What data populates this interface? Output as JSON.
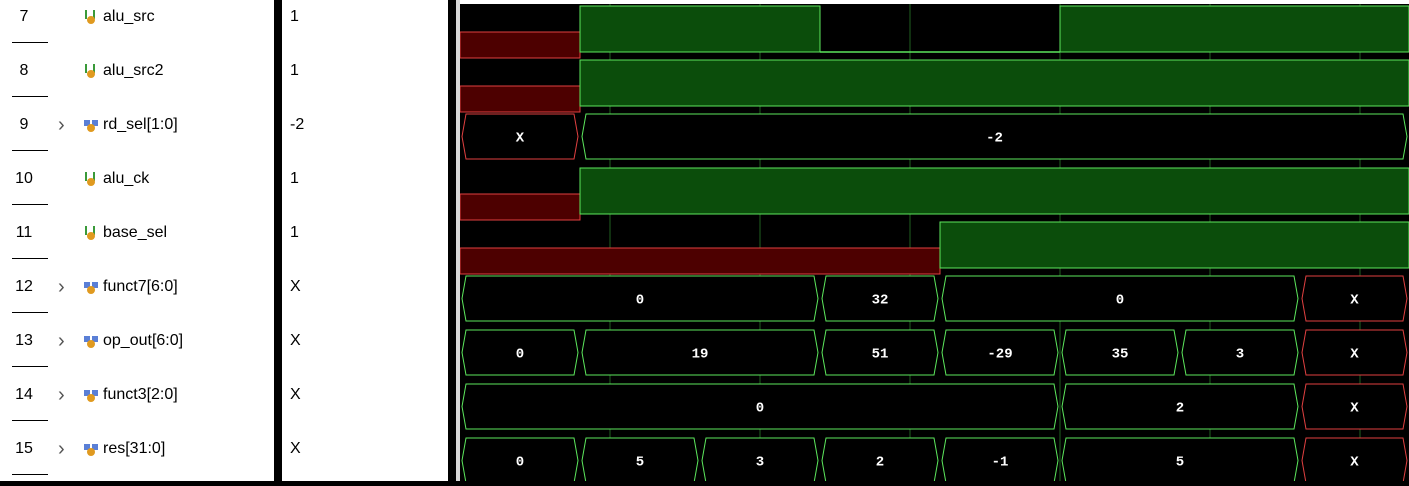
{
  "signals": [
    {
      "num": "7",
      "name": "alu_src",
      "value": "1",
      "expandable": false,
      "icon": "bit-signal-icon"
    },
    {
      "num": "8",
      "name": "alu_src2",
      "value": "1",
      "expandable": false,
      "icon": "bit-signal-icon"
    },
    {
      "num": "9",
      "name": "rd_sel[1:0]",
      "value": "-2",
      "expandable": true,
      "icon": "bus-signal-icon"
    },
    {
      "num": "10",
      "name": "alu_ck",
      "value": "1",
      "expandable": false,
      "icon": "bit-signal-icon"
    },
    {
      "num": "11",
      "name": "base_sel",
      "value": "1",
      "expandable": false,
      "icon": "bit-signal-icon"
    },
    {
      "num": "12",
      "name": "funct7[6:0]",
      "value": "X",
      "expandable": true,
      "icon": "bus-signal-icon"
    },
    {
      "num": "13",
      "name": "op_out[6:0]",
      "value": "X",
      "expandable": true,
      "icon": "bus-signal-icon"
    },
    {
      "num": "14",
      "name": "funct3[2:0]",
      "value": "X",
      "expandable": true,
      "icon": "bus-signal-icon"
    },
    {
      "num": "15",
      "name": "res[31:0]",
      "value": "X",
      "expandable": true,
      "icon": "bus-signal-icon"
    }
  ],
  "waveforms": {
    "alu_src": [
      {
        "v": "X",
        "t0": 0,
        "t1": 120
      },
      {
        "v": "1",
        "t0": 120,
        "t1": 360
      },
      {
        "v": "0",
        "t0": 360,
        "t1": 600
      },
      {
        "v": "1",
        "t0": 600,
        "t1": 949
      }
    ],
    "alu_src2": [
      {
        "v": "X",
        "t0": 0,
        "t1": 120
      },
      {
        "v": "1",
        "t0": 120,
        "t1": 949
      }
    ],
    "rd_sel": [
      {
        "v": "X",
        "t0": 0,
        "t1": 120
      },
      {
        "v": "-2",
        "t0": 120,
        "t1": 949
      }
    ],
    "alu_ck": [
      {
        "v": "X",
        "t0": 0,
        "t1": 120
      },
      {
        "v": "1",
        "t0": 120,
        "t1": 949
      }
    ],
    "base_sel": [
      {
        "v": "X",
        "t0": 0,
        "t1": 480
      },
      {
        "v": "1",
        "t0": 480,
        "t1": 949
      }
    ],
    "funct7": [
      {
        "v": "0",
        "t0": 0,
        "t1": 360
      },
      {
        "v": "32",
        "t0": 360,
        "t1": 480
      },
      {
        "v": "0",
        "t0": 480,
        "t1": 840
      },
      {
        "v": "X",
        "t0": 840,
        "t1": 949
      }
    ],
    "op_out": [
      {
        "v": "0",
        "t0": 0,
        "t1": 120
      },
      {
        "v": "19",
        "t0": 120,
        "t1": 360
      },
      {
        "v": "51",
        "t0": 360,
        "t1": 480
      },
      {
        "v": "-29",
        "t0": 480,
        "t1": 600
      },
      {
        "v": "35",
        "t0": 600,
        "t1": 720
      },
      {
        "v": "3",
        "t0": 720,
        "t1": 840
      },
      {
        "v": "X",
        "t0": 840,
        "t1": 949
      }
    ],
    "funct3": [
      {
        "v": "0",
        "t0": 0,
        "t1": 600
      },
      {
        "v": "2",
        "t0": 600,
        "t1": 840
      },
      {
        "v": "X",
        "t0": 840,
        "t1": 949
      }
    ],
    "res": [
      {
        "v": "0",
        "t0": 0,
        "t1": 120
      },
      {
        "v": "5",
        "t0": 120,
        "t1": 240
      },
      {
        "v": "3",
        "t0": 240,
        "t1": 360
      },
      {
        "v": "2",
        "t0": 360,
        "t1": 480
      },
      {
        "v": "-1",
        "t0": 480,
        "t1": 600
      },
      {
        "v": "5",
        "t0": 600,
        "t1": 840
      },
      {
        "v": "X",
        "t0": 840,
        "t1": 949
      }
    ]
  },
  "colors": {
    "logic_high_fill": "#0b4d0b",
    "logic_unknown_fill": "#4d0000",
    "valid_edge": "#5ce65c",
    "unknown_edge": "#e04040",
    "grid": "#1f5f1f"
  }
}
